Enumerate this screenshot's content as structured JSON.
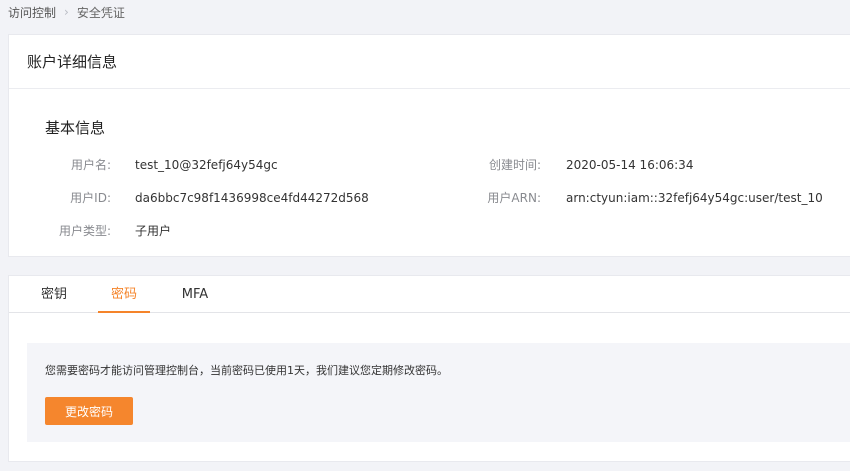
{
  "breadcrumb": {
    "items": [
      "访问控制",
      "安全凭证"
    ],
    "separator": "›"
  },
  "account_card": {
    "title": "账户详细信息",
    "section_title": "基本信息",
    "fields": {
      "username": {
        "label": "用户名:",
        "value": "test_10@32fefj64y54gc"
      },
      "created": {
        "label": "创建时间:",
        "value": "2020-05-14 16:06:34"
      },
      "user_id": {
        "label": "用户ID:",
        "value": "da6bbc7c98f1436998ce4fd44272d568"
      },
      "user_arn": {
        "label": "用户ARN:",
        "value": "arn:ctyun:iam::32fefj64y54gc:user/test_10"
      },
      "user_type": {
        "label": "用户类型:",
        "value": "子用户"
      }
    }
  },
  "credentials_card": {
    "tabs": [
      {
        "label": "密钥",
        "active": false
      },
      {
        "label": "密码",
        "active": true
      },
      {
        "label": "MFA",
        "active": false
      }
    ],
    "password_panel": {
      "message": "您需要密码才能访问管理控制台，当前密码已使用1天，我们建议您定期修改密码。",
      "button_label": "更改密码"
    }
  },
  "colors": {
    "accent": "#f5842a",
    "page_background": "#f2f3f7",
    "panel_background": "#f4f5f9"
  }
}
